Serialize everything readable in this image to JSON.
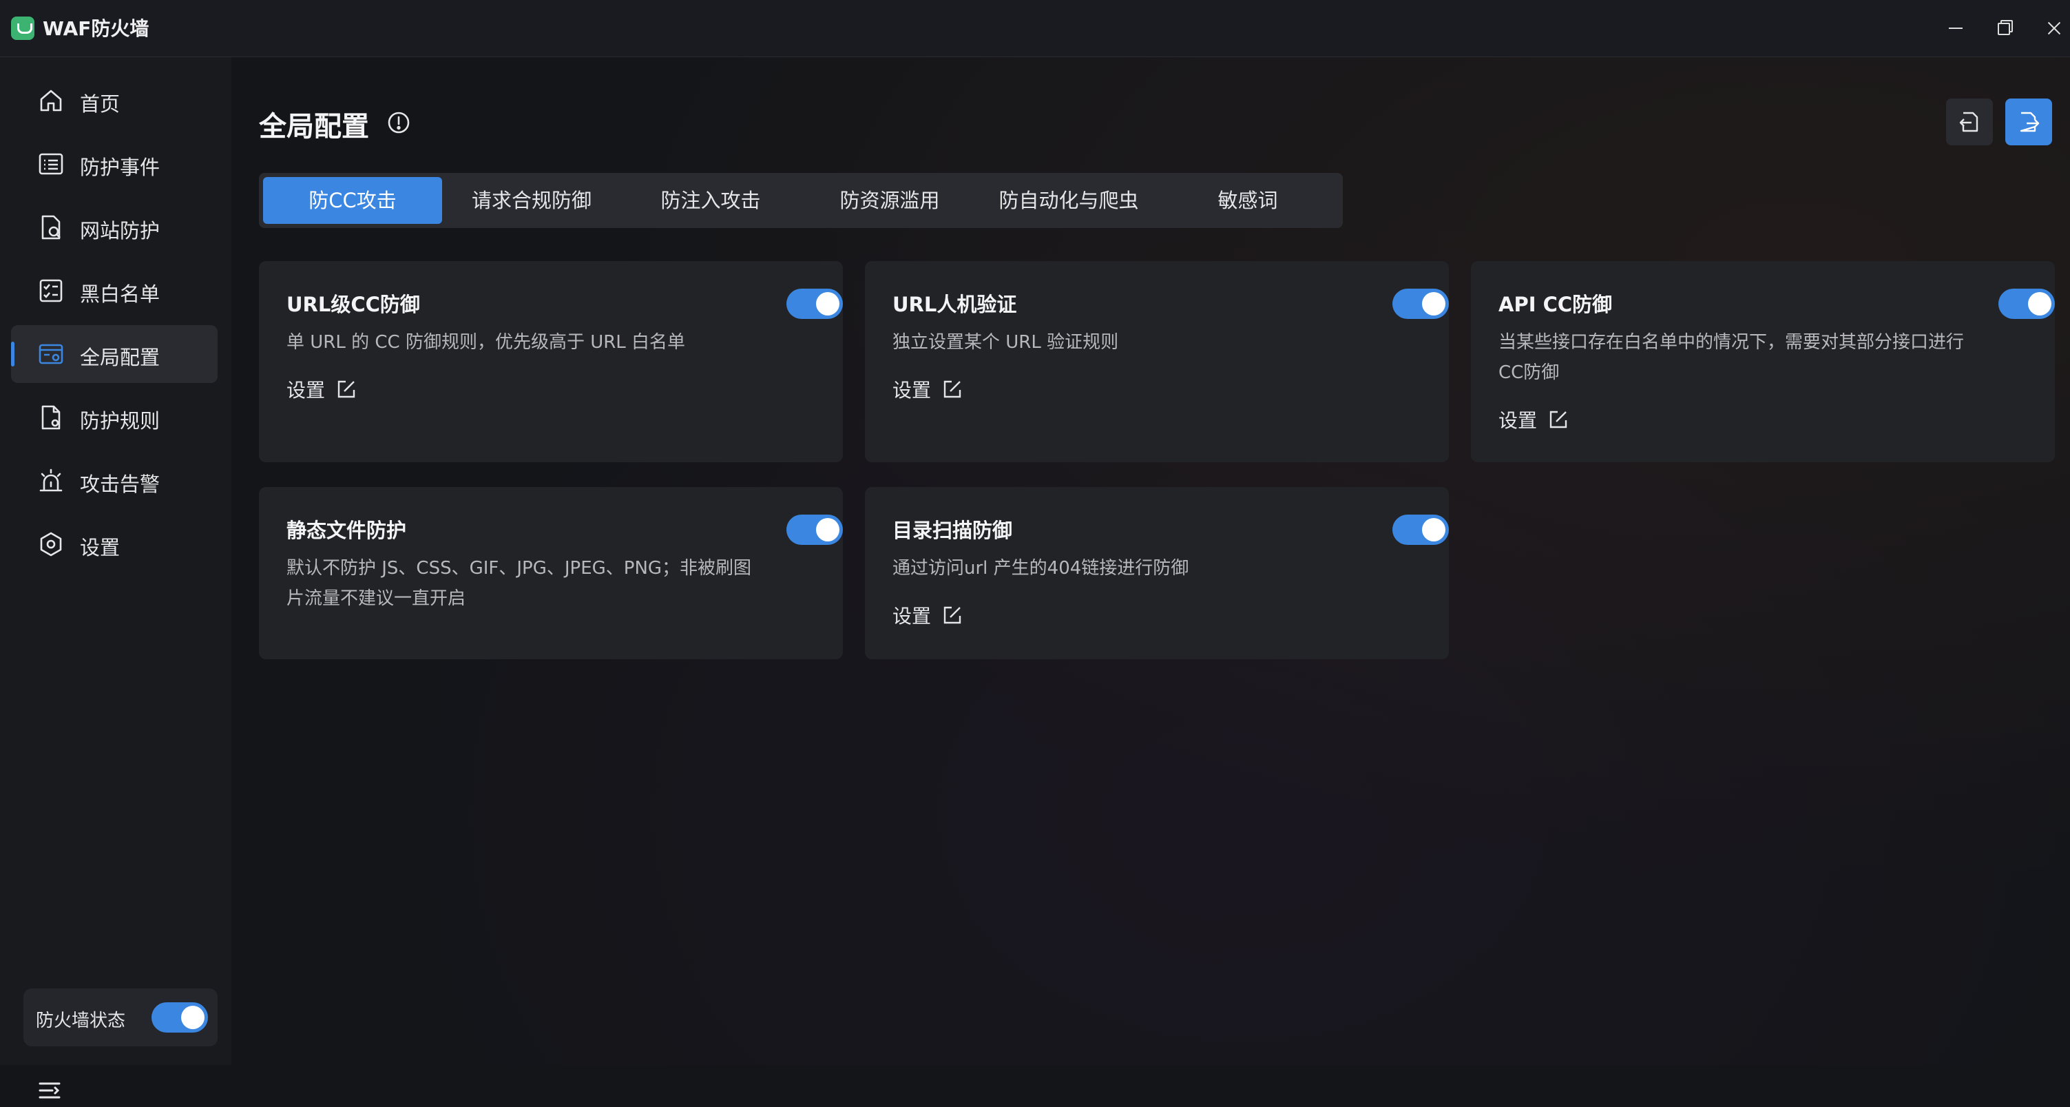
{
  "app": {
    "title": "WAF防火墙"
  },
  "sidebar": {
    "items": [
      {
        "label": "首页",
        "icon": "home-icon"
      },
      {
        "label": "防护事件",
        "icon": "list-icon"
      },
      {
        "label": "网站防护",
        "icon": "shield-file-icon"
      },
      {
        "label": "黑白名单",
        "icon": "checklist-icon"
      },
      {
        "label": "全局配置",
        "icon": "global-config-icon",
        "active": true
      },
      {
        "label": "防护规则",
        "icon": "rule-file-icon"
      },
      {
        "label": "攻击告警",
        "icon": "alarm-icon"
      },
      {
        "label": "设置",
        "icon": "gear-icon"
      }
    ],
    "firewall_status_label": "防火墙状态",
    "firewall_status_on": true
  },
  "main": {
    "title": "全局配置",
    "tabs": [
      {
        "label": "防CC攻击",
        "active": true
      },
      {
        "label": "请求合规防御"
      },
      {
        "label": "防注入攻击"
      },
      {
        "label": "防资源滥用"
      },
      {
        "label": "防自动化与爬虫"
      },
      {
        "label": "敏感词"
      }
    ],
    "cards": [
      {
        "title": "URL级CC防御",
        "desc": "单 URL 的 CC 防御规则，优先级高于 URL 白名单",
        "setting": "设置",
        "enabled": true
      },
      {
        "title": "URL人机验证",
        "desc": "独立设置某个 URL 验证规则",
        "setting": "设置",
        "enabled": true
      },
      {
        "title": "API CC防御",
        "desc": "当某些接口存在白名单中的情况下，需要对其部分接口进行CC防御",
        "setting": "设置",
        "enabled": true
      },
      {
        "title": "静态文件防护",
        "desc": "默认不防护 JS、CSS、GIF、JPG、JPEG、PNG；非被刷图片流量不建议一直开启",
        "enabled": true
      },
      {
        "title": "目录扫描防御",
        "desc": "通过访问url 产生的404链接进行防御",
        "setting": "设置",
        "enabled": true
      }
    ]
  },
  "colors": {
    "accent": "#3a86e0",
    "background": "#141519",
    "card": "#222327"
  }
}
